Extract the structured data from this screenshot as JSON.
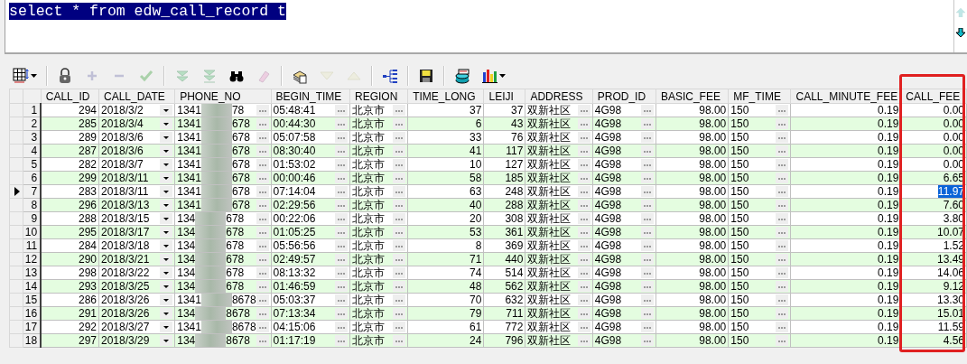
{
  "editor": {
    "sql": "select * from edw_call_record t",
    "sql_selected": true
  },
  "toolbar": [
    {
      "kind": "grid",
      "disabled": false,
      "has_menu": true
    },
    {
      "kind": "sep"
    },
    {
      "kind": "lock",
      "disabled": false,
      "has_menu": false
    },
    {
      "kind": "add",
      "disabled": true,
      "has_menu": false
    },
    {
      "kind": "remove",
      "disabled": true,
      "has_menu": false
    },
    {
      "kind": "confirm",
      "disabled": true,
      "has_menu": false
    },
    {
      "kind": "sep"
    },
    {
      "kind": "next",
      "disabled": true,
      "has_menu": false
    },
    {
      "kind": "last",
      "disabled": true,
      "has_menu": false
    },
    {
      "kind": "find",
      "disabled": false,
      "has_menu": false
    },
    {
      "kind": "clear",
      "disabled": true,
      "has_menu": false
    },
    {
      "kind": "sep"
    },
    {
      "kind": "papers",
      "disabled": false,
      "has_menu": false
    },
    {
      "kind": "down",
      "disabled": true,
      "has_menu": false
    },
    {
      "kind": "up",
      "disabled": true,
      "has_menu": false
    },
    {
      "kind": "sep"
    },
    {
      "kind": "tree",
      "disabled": false,
      "has_menu": false
    },
    {
      "kind": "sep"
    },
    {
      "kind": "save",
      "disabled": false,
      "has_menu": false
    },
    {
      "kind": "sep"
    },
    {
      "kind": "database",
      "disabled": false,
      "has_menu": false
    },
    {
      "kind": "chart",
      "disabled": false,
      "has_menu": true
    }
  ],
  "columns": [
    {
      "label": "CALL_ID",
      "kind": "number",
      "selected": false,
      "framed": false
    },
    {
      "label": "CALL_DATE",
      "kind": "date",
      "selected": false,
      "framed": false
    },
    {
      "label": "PHONE_NO",
      "kind": "masked",
      "selected": false,
      "framed": false
    },
    {
      "label": "BEGIN_TIME",
      "kind": "text",
      "selected": false,
      "framed": false
    },
    {
      "label": "REGION",
      "kind": "text",
      "selected": false,
      "framed": false
    },
    {
      "label": "TIME_LONG",
      "kind": "number",
      "selected": false,
      "framed": false
    },
    {
      "label": "LEIJI",
      "kind": "number",
      "selected": false,
      "framed": false
    },
    {
      "label": "ADDRESS",
      "kind": "text",
      "selected": false,
      "framed": false
    },
    {
      "label": "PROD_ID",
      "kind": "text",
      "selected": false,
      "framed": false
    },
    {
      "label": "BASIC_FEE",
      "kind": "number",
      "selected": false,
      "framed": false
    },
    {
      "label": "MF_TIME",
      "kind": "text",
      "selected": false,
      "framed": false
    },
    {
      "label": "CALL_MINUTE_FEE",
      "kind": "number",
      "selected": false,
      "framed": false
    },
    {
      "label": "CALL_FEE",
      "kind": "number",
      "selected": true,
      "framed": true
    }
  ],
  "rows": [
    {
      "number": "1",
      "selected": false,
      "cells": [
        "294",
        "2018/3/2",
        {
          "prefix": "1341",
          "suffix": "78"
        },
        "05:48:41",
        "北京市",
        "37",
        "37",
        "双新社区",
        "4G98",
        "98.00",
        "150",
        "0.19",
        "0.00"
      ]
    },
    {
      "number": "2",
      "selected": false,
      "cells": [
        "285",
        "2018/3/4",
        {
          "prefix": "1341",
          "suffix": "678"
        },
        "00:44:30",
        "北京市",
        "6",
        "43",
        "双新社区",
        "4G98",
        "98.00",
        "150",
        "0.19",
        "0.00"
      ]
    },
    {
      "number": "3",
      "selected": false,
      "cells": [
        "289",
        "2018/3/6",
        {
          "prefix": "1341",
          "suffix": "678"
        },
        "05:07:58",
        "北京市",
        "33",
        "76",
        "双新社区",
        "4G98",
        "98.00",
        "150",
        "0.19",
        "0.00"
      ]
    },
    {
      "number": "4",
      "selected": false,
      "cells": [
        "287",
        "2018/3/6",
        {
          "prefix": "1341",
          "suffix": "678"
        },
        "08:30:40",
        "北京市",
        "41",
        "117",
        "双新社区",
        "4G98",
        "98.00",
        "150",
        "0.19",
        "0.00"
      ]
    },
    {
      "number": "5",
      "selected": false,
      "cells": [
        "282",
        "2018/3/7",
        {
          "prefix": "1341",
          "suffix": "678"
        },
        "01:53:02",
        "北京市",
        "10",
        "127",
        "双新社区",
        "4G98",
        "98.00",
        "150",
        "0.19",
        "0.00"
      ]
    },
    {
      "number": "6",
      "selected": false,
      "cells": [
        "299",
        "2018/3/11",
        {
          "prefix": "1341",
          "suffix": "678"
        },
        "00:00:46",
        "北京市",
        "58",
        "185",
        "双新社区",
        "4G98",
        "98.00",
        "150",
        "0.19",
        "6.65"
      ]
    },
    {
      "number": "7",
      "selected": true,
      "cells": [
        "283",
        "2018/3/11",
        {
          "prefix": "1341",
          "suffix": "678"
        },
        "07:14:04",
        "北京市",
        "63",
        "248",
        "双新社区",
        "4G98",
        "98.00",
        "150",
        "0.19",
        "11.97"
      ]
    },
    {
      "number": "8",
      "selected": false,
      "cells": [
        "296",
        "2018/3/13",
        {
          "prefix": "1341",
          "suffix": "678"
        },
        "02:29:56",
        "北京市",
        "40",
        "288",
        "双新社区",
        "4G98",
        "98.00",
        "150",
        "0.19",
        "7.60"
      ]
    },
    {
      "number": "9",
      "selected": false,
      "cells": [
        "288",
        "2018/3/15",
        {
          "prefix": "134",
          "suffix": "678"
        },
        "00:22:06",
        "北京市",
        "20",
        "308",
        "双新社区",
        "4G98",
        "98.00",
        "150",
        "0.19",
        "3.80"
      ]
    },
    {
      "number": "10",
      "selected": false,
      "cells": [
        "295",
        "2018/3/17",
        {
          "prefix": "134",
          "suffix": "678"
        },
        "01:05:25",
        "北京市",
        "53",
        "361",
        "双新社区",
        "4G98",
        "98.00",
        "150",
        "0.19",
        "10.07"
      ]
    },
    {
      "number": "11",
      "selected": false,
      "cells": [
        "284",
        "2018/3/18",
        {
          "prefix": "134",
          "suffix": "678"
        },
        "05:56:56",
        "北京市",
        "8",
        "369",
        "双新社区",
        "4G98",
        "98.00",
        "150",
        "0.19",
        "1.52"
      ]
    },
    {
      "number": "12",
      "selected": false,
      "cells": [
        "290",
        "2018/3/21",
        {
          "prefix": "134",
          "suffix": "678"
        },
        "02:49:57",
        "北京市",
        "71",
        "440",
        "双新社区",
        "4G98",
        "98.00",
        "150",
        "0.19",
        "13.49"
      ]
    },
    {
      "number": "13",
      "selected": false,
      "cells": [
        "298",
        "2018/3/22",
        {
          "prefix": "134",
          "suffix": "678"
        },
        "08:13:32",
        "北京市",
        "74",
        "514",
        "双新社区",
        "4G98",
        "98.00",
        "150",
        "0.19",
        "14.06"
      ]
    },
    {
      "number": "14",
      "selected": false,
      "cells": [
        "293",
        "2018/3/25",
        {
          "prefix": "134",
          "suffix": "678"
        },
        "01:46:59",
        "北京市",
        "48",
        "562",
        "双新社区",
        "4G98",
        "98.00",
        "150",
        "0.19",
        "9.12"
      ]
    },
    {
      "number": "15",
      "selected": false,
      "cells": [
        "286",
        "2018/3/26",
        {
          "prefix": "1341",
          "suffix": "8678"
        },
        "05:03:37",
        "北京市",
        "70",
        "632",
        "双新社区",
        "4G98",
        "98.00",
        "150",
        "0.19",
        "13.30"
      ]
    },
    {
      "number": "16",
      "selected": false,
      "cells": [
        "291",
        "2018/3/26",
        {
          "prefix": "134",
          "suffix": "8678"
        },
        "07:13:34",
        "北京市",
        "79",
        "711",
        "双新社区",
        "4G98",
        "98.00",
        "150",
        "0.19",
        "15.01"
      ]
    },
    {
      "number": "17",
      "selected": false,
      "cells": [
        "292",
        "2018/3/27",
        {
          "prefix": "1341",
          "suffix": "8678"
        },
        "04:15:06",
        "北京市",
        "61",
        "772",
        "双新社区",
        "4G98",
        "98.00",
        "150",
        "0.19",
        "11.59"
      ]
    },
    {
      "number": "18",
      "selected": false,
      "cells": [
        "297",
        "2018/3/29",
        {
          "prefix": "134",
          "suffix": "8678"
        },
        "01:17:19",
        "北京市",
        "24",
        "796",
        "双新社区",
        "4G98",
        "98.00",
        "150",
        "0.19",
        "4.56"
      ]
    }
  ]
}
